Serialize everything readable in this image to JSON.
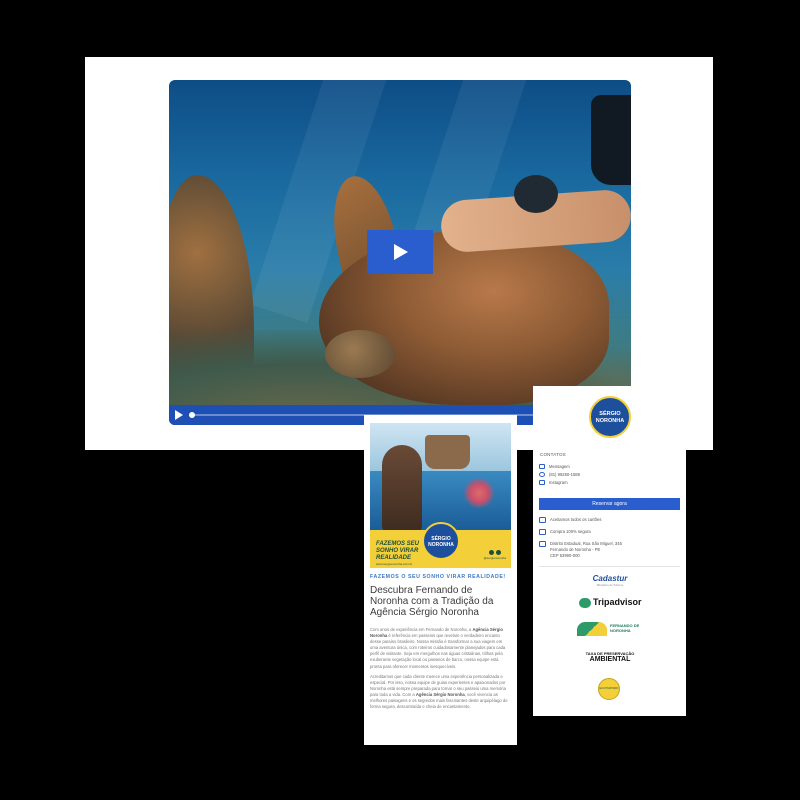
{
  "video": {
    "play_label": "Play video"
  },
  "article": {
    "hero": {
      "slogan": "FAZEMOS SEU SONHO VIRAR REALIDADE",
      "site": "www.sergionoronha.com.br",
      "seal_line1": "SÉRGIO",
      "seal_line2": "NORONHA",
      "handle": "@sergionoronha"
    },
    "kicker": "FAZEMOS O SEU SONHO VIRAR REALIDADE!",
    "title": "Descubra Fernando de Noronha com a Tradição da Agência Sérgio Noronha",
    "p1_start": "Com anos de experiência em Fernando de Noronha, a ",
    "p1_brand": "Agência Sérgio Noronha",
    "p1_end": " é referência em passeios que revelam o verdadeiro encanto desse paraíso brasileiro. Nossa missão é transformar a sua viagem em uma aventura única, com roteiros cuidadosamente planejados para cada perfil de visitante. Seja em mergulhos nas águas cristalinas, trilhas pela exuberante vegetação local ou passeios de barco, nossa equipe está pronta para oferecer momentos inesquecíveis.",
    "p2_start": "Acreditamos que cada cliente merece uma experiência personalizada e especial. Por isso, nossa equipe de guias experientes e apaixonados por Noronha está sempre preparada para tornar o seu passeio uma memória para toda a vida. Com a ",
    "p2_brand": "Agência Sérgio Noronha",
    "p2_end": ", você vivencia as melhores paisagens e os segredos mais fascinantes deste arquipélago de forma segura, descontraída e cheia de encantamento."
  },
  "sidebar": {
    "logo_line1": "SÉRGIO",
    "logo_line2": "NORONHA",
    "contacts_title": "CONTATOS",
    "contacts": [
      {
        "icon": "envelope-icon",
        "label": "Mensagem"
      },
      {
        "icon": "whatsapp-icon",
        "label": "(81) 99250-1588"
      },
      {
        "icon": "instagram-icon",
        "label": "Instagram"
      }
    ],
    "reserve_label": "Reservar agora",
    "features": [
      {
        "icon": "credit-card-icon",
        "label": "Aceitamos todos os cartões"
      },
      {
        "icon": "secure-icon",
        "label": "Compra 100% segura"
      },
      {
        "icon": "location-icon",
        "line1": "Distrito Estadual, Rua São Miguel, 345",
        "line2": "Fernando de Noronha - PE",
        "line3": "CEP 53990-000"
      }
    ],
    "cadastur": {
      "name": "Cadastur",
      "sub": "Ministério do Turismo"
    },
    "tripadvisor": "Tripadvisor",
    "noronha_logo": {
      "line1": "FERNANDO DE",
      "line2": "NORONHA"
    },
    "taxa": {
      "line1": "TAXA DE PRESERVAÇÃO",
      "line2": "AMBIENTAL"
    },
    "seal_text": "ECOTURISMO"
  },
  "colors": {
    "accent": "#2a5ecf",
    "kicker": "#3a78c8",
    "brand_blue": "#1d4f9c",
    "brand_yellow": "#f3cf3a"
  }
}
